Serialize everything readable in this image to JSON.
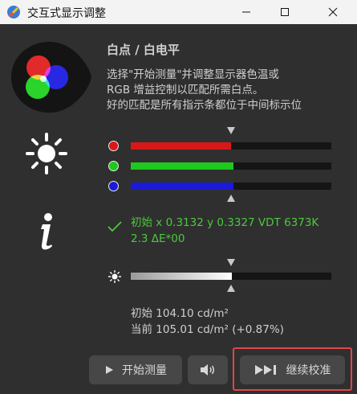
{
  "window": {
    "title": "交互式显示调整",
    "minimize_icon": "minimize-icon",
    "maximize_icon": "maximize-icon",
    "close_icon": "close-icon"
  },
  "header": {
    "title": "白点 / 白电平",
    "instructions": [
      "选择\"开始测量\"并调整显示器色温或",
      "RGB 增益控制以匹配所需白点。",
      "好的匹配是所有指示条都位于中间标示位"
    ]
  },
  "channels": [
    {
      "name": "red",
      "color": "#d81818",
      "level": 0.5
    },
    {
      "name": "green",
      "color": "#1ec81e",
      "level": 0.51
    },
    {
      "name": "blue",
      "color": "#1a1ad8",
      "level": 0.51
    }
  ],
  "result": {
    "line1": "初始 x 0.3132 y 0.3327 VDT 6373K",
    "line2": "2.3 ΔE*00",
    "color": "#4cc93e"
  },
  "luminance": {
    "level": 0.505,
    "initial": "初始 104.10 cd/m²",
    "current": "当前 105.01 cd/m² (+0.87%)"
  },
  "buttons": {
    "start_label": "开始测量",
    "start_icon": "play-icon",
    "sound_icon": "speaker-icon",
    "continue_label": "继续校准",
    "continue_icon": "skip-forward-icon"
  }
}
